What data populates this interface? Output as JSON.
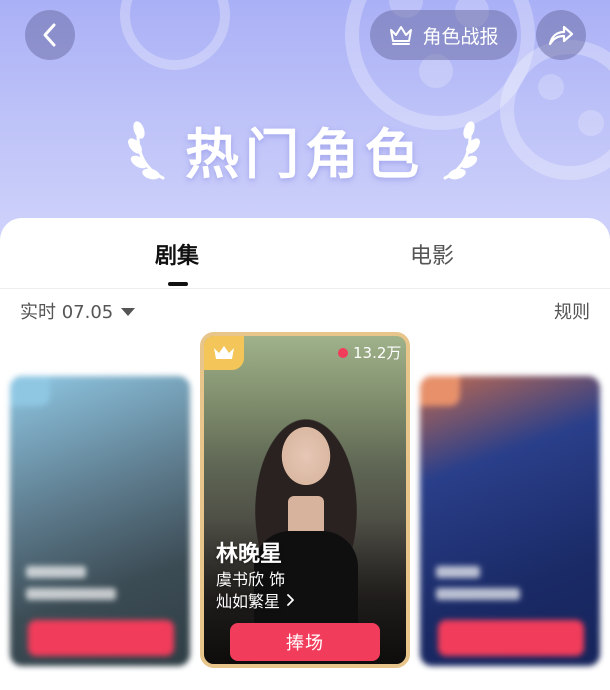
{
  "header": {
    "report_label": "角色战报",
    "title": "热门角色",
    "icons": {
      "back": "chevron-left-icon",
      "report": "crown-icon",
      "share": "share-arrow-icon"
    },
    "colors": {
      "bg_top": "#aab0f6",
      "bg_bottom": "#cfd2fa"
    }
  },
  "tabs": [
    {
      "label": "剧集",
      "active": true
    },
    {
      "label": "电影",
      "active": false
    }
  ],
  "filter": {
    "label": "实时 07.05"
  },
  "rules_label": "规则",
  "cards": {
    "center": {
      "heat": "13.2万",
      "character_name": "林晚星",
      "actor": "虞书欣 饰",
      "drama": "灿如繁星",
      "button_label": "捧场"
    }
  },
  "colors": {
    "accent": "#f23c5b",
    "gold": "#e8c58a",
    "crown": "#f4c65a"
  }
}
